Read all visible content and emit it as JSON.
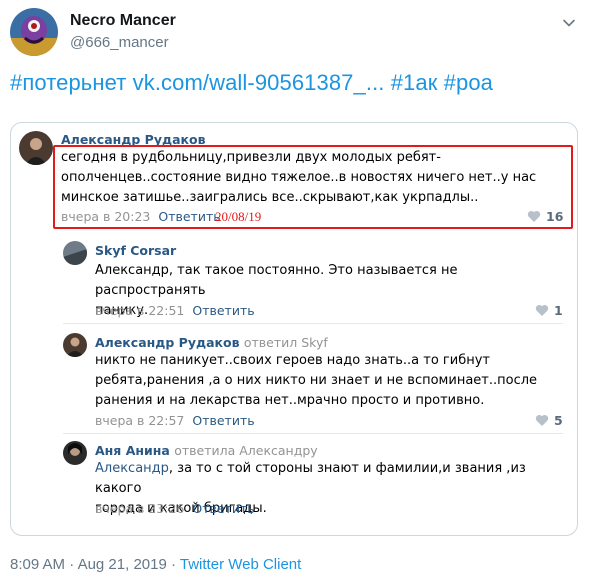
{
  "tweet": {
    "display_name": "Necro Mancer",
    "handle": "@666_mancer",
    "text_parts": [
      "#потерьнет",
      "vk.com/wall-90561387_...",
      "#1ак",
      "#роа"
    ],
    "footer": {
      "time": "8:09 AM",
      "date": "Aug 21, 2019",
      "separator": "·",
      "client": "Twitter Web Client"
    }
  },
  "vk_screenshot": {
    "comments": [
      {
        "author": "Александр Рудаков",
        "reply_to": "",
        "lines": [
          "сегодня в рудбольницу,привезли двух молодых ребят-",
          "ополченцев..состояние видно тяжелое..в новостях ничего нет..у нас",
          "минское затишье..заигрались все..скрывают,как укрпадлы.."
        ],
        "time": "вчера в 20:23",
        "reply_label": "Ответить",
        "likes": "16",
        "annotation_date": "20/08/19"
      },
      {
        "author": "Skyf Corsar",
        "reply_to": "",
        "lines": [
          "Александр, так такое постоянно. Это называется не распространять",
          "панику."
        ],
        "time": "вчера в 22:51",
        "reply_label": "Ответить",
        "likes": "1"
      },
      {
        "author": "Александр Рудаков",
        "reply_to": "ответил Skyf",
        "lines": [
          "никто не паникует..своих героев надо знать..а то гибнут",
          "ребята,ранения ,а о них никто ни знает и не вспоминает..после",
          "ранения и на лекарства нет..мрачно просто и противно."
        ],
        "time": "вчера в 22:57",
        "reply_label": "Ответить",
        "likes": "5"
      },
      {
        "author": "Аня Анина",
        "reply_to": "ответила Александру",
        "mention": "Александр",
        "lines": [
          ", за то с той стороны знают и фамилии,и звания ,из какого",
          "города и какой бригады."
        ],
        "time": "вчера в 23:26",
        "reply_label": "Ответить",
        "likes": ""
      }
    ]
  },
  "colors": {
    "accent": "#1b95e0",
    "vk_link": "#2a5885",
    "highlight": "#e21a1a",
    "muted": "#657786"
  },
  "icons": [
    "avatar",
    "chevron-down-icon",
    "heart-icon"
  ]
}
